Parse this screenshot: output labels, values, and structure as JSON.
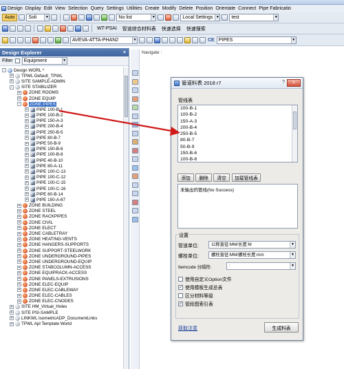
{
  "titlebar": {
    "title": ""
  },
  "menu": [
    "Design",
    "Display",
    "Edit",
    "View",
    "Selection",
    "Query",
    "Settings",
    "Utilities",
    "Create",
    "Modify",
    "Delete",
    "Position",
    "Orientate",
    "Connect",
    "Pipe Fabricatio"
  ],
  "toolbar1": {
    "auto_label": "Auto",
    "solid_value": "Soli",
    "list_value": "No list",
    "settings_value": "Local Settings",
    "test_value": "test"
  },
  "toolbar2": {
    "wt_psai": "WT-PSAI",
    "mto_label": "管道综合材料表",
    "quick_select": "快速选择",
    "quick_search": "快速搜索"
  },
  "toolbar3": {
    "ref_value": "AVEVA-ATTA-PHAN2",
    "ce_label": "CE",
    "ce_value": "PIPES"
  },
  "explorer": {
    "title": "Design Explorer",
    "close": "×",
    "filter_label": "Filter",
    "filter_value": "Equipment",
    "tree": [
      {
        "label": "Design WORL *",
        "level": 0,
        "exp": "-",
        "icon": "world"
      },
      {
        "label": "TPWL Default_TPWL",
        "level": 1,
        "exp": "+",
        "icon": "site"
      },
      {
        "label": "SITE SAMPLE-ADMIN",
        "level": 1,
        "exp": "+",
        "icon": "site"
      },
      {
        "label": "SITE STABILIZER",
        "level": 1,
        "exp": "-",
        "icon": "site"
      },
      {
        "label": "ZONE ROOMS",
        "level": 2,
        "exp": "+",
        "icon": "zone"
      },
      {
        "label": "ZONE EQUIP",
        "level": 2,
        "exp": "+",
        "icon": "zone"
      },
      {
        "label": "ZONE PIPES",
        "level": 2,
        "exp": "-",
        "icon": "zone",
        "selected": true
      },
      {
        "label": "PIPE 100-B-1",
        "level": 3,
        "exp": "+",
        "icon": "pipe"
      },
      {
        "label": "PIPE 100-B-2",
        "level": 3,
        "exp": "+",
        "icon": "pipe"
      },
      {
        "label": "PIPE 150-A-3",
        "level": 3,
        "exp": "+",
        "icon": "pipe"
      },
      {
        "label": "PIPE 200-B-4",
        "level": 3,
        "exp": "+",
        "icon": "pipe"
      },
      {
        "label": "PIPE 250-B-5",
        "level": 3,
        "exp": "+",
        "icon": "pipe"
      },
      {
        "label": "PIPE 80-B-7",
        "level": 3,
        "exp": "+",
        "icon": "pipe"
      },
      {
        "label": "PIPE 50-B-9",
        "level": 3,
        "exp": "+",
        "icon": "pipe"
      },
      {
        "label": "PIPE 150-B-6",
        "level": 3,
        "exp": "+",
        "icon": "pipe"
      },
      {
        "label": "PIPE 100-B-8",
        "level": 3,
        "exp": "+",
        "icon": "pipe"
      },
      {
        "label": "PIPE 40-B-10",
        "level": 3,
        "exp": "+",
        "icon": "pipe"
      },
      {
        "label": "PIPE 80-A-11",
        "level": 3,
        "exp": "+",
        "icon": "pipe"
      },
      {
        "label": "PIPE 100-C-13",
        "level": 3,
        "exp": "+",
        "icon": "pipe"
      },
      {
        "label": "PIPE 100-C-12",
        "level": 3,
        "exp": "+",
        "icon": "pipe"
      },
      {
        "label": "PIPE 100-C-15",
        "level": 3,
        "exp": "+",
        "icon": "pipe"
      },
      {
        "label": "PIPE 100-C-16",
        "level": 3,
        "exp": "+",
        "icon": "pipe"
      },
      {
        "label": "PIPE 80-B-14",
        "level": 3,
        "exp": "+",
        "icon": "pipe"
      },
      {
        "label": "PIPE 150-A-67",
        "level": 3,
        "exp": "+",
        "icon": "pipe"
      },
      {
        "label": "ZONE BUILDING",
        "level": 2,
        "exp": "+",
        "icon": "zone"
      },
      {
        "label": "ZONE STEEL",
        "level": 2,
        "exp": "+",
        "icon": "zone"
      },
      {
        "label": "ZONE RACKPIPES",
        "level": 2,
        "exp": "+",
        "icon": "zone"
      },
      {
        "label": "ZONE CIVIL",
        "level": 2,
        "exp": "+",
        "icon": "zone"
      },
      {
        "label": "ZONE ELECT",
        "level": 2,
        "exp": "+",
        "icon": "zone"
      },
      {
        "label": "ZONE CABLETRAY",
        "level": 2,
        "exp": "+",
        "icon": "zone"
      },
      {
        "label": "ZONE HEATING-VENTS",
        "level": 2,
        "exp": "+",
        "icon": "zone"
      },
      {
        "label": "ZONE HANGERS-SUPPORTS",
        "level": 2,
        "exp": "+",
        "icon": "zone"
      },
      {
        "label": "ZONE SUPPORT-STEELWORK",
        "level": 2,
        "exp": "+",
        "icon": "zone"
      },
      {
        "label": "ZONE UNDERGROUND-PIPES",
        "level": 2,
        "exp": "+",
        "icon": "zone"
      },
      {
        "label": "ZONE UNDERGROUND-EQUIP",
        "level": 2,
        "exp": "+",
        "icon": "zone"
      },
      {
        "label": "ZONE STABCOLUMN-ACCESS",
        "level": 2,
        "exp": "+",
        "icon": "zone"
      },
      {
        "label": "ZONE EQUIPRACK-ACCESS",
        "level": 2,
        "exp": "+",
        "icon": "zone"
      },
      {
        "label": "ZONE PANELS-EXTRUSIONS",
        "level": 2,
        "exp": "+",
        "icon": "zone"
      },
      {
        "label": "ZONE ELEC-EQUIP",
        "level": 2,
        "exp": "+",
        "icon": "zone"
      },
      {
        "label": "ZONE ELEC-CABLEWAY",
        "level": 2,
        "exp": "+",
        "icon": "zone"
      },
      {
        "label": "ZONE ELEC-CABLES",
        "level": 2,
        "exp": "+",
        "icon": "zone"
      },
      {
        "label": "ZONE ELEC-CNODES",
        "level": 2,
        "exp": "+",
        "icon": "zone"
      },
      {
        "label": "SITE HM_Virtual_Holes",
        "level": 1,
        "exp": "+",
        "icon": "site"
      },
      {
        "label": "SITE PSI-SAMPLE",
        "level": 1,
        "exp": "+",
        "icon": "site"
      },
      {
        "label": "LINKWL IsometricADP_DocumentLinks",
        "level": 1,
        "exp": "+",
        "icon": "site"
      },
      {
        "label": "TPWL Apl Template World",
        "level": 1,
        "exp": "+",
        "icon": "site"
      }
    ]
  },
  "navigate_label": "Navigate :",
  "dialog": {
    "title": "管道料表 2018 r7",
    "help": "?",
    "close": "×",
    "pipe_table_label": "管线表",
    "pipes": [
      "100-B-1",
      "100-B-2",
      "150-A-3",
      "200-B-4",
      "250-B-5",
      "80-B-7",
      "50-B-9",
      "150-B-6",
      "100-B-8"
    ],
    "btn_add": "添加",
    "btn_delete": "删除",
    "btn_clear": "清空",
    "btn_load": "加载管线表",
    "message": "未输出的管线(No Success)",
    "settings_label": "设置",
    "pipe_unit_label": "管道单位:",
    "pipe_unit_value": "公称直径:MM/长度:M",
    "bolt_unit_label": "螺栓单位:",
    "bolt_unit_value": "螺栓直径:MM/螺栓长度:mm",
    "itemcode_label": "Itemcode 分隔符:",
    "itemcode_value": ":",
    "chk_custom_option": "使用自定义Option文件",
    "chk_template": "使用模板生成总表",
    "chk_material_grade": "区分材料等级",
    "chk_drawing_index": "管段图索引表",
    "checks_state": [
      false,
      true,
      false,
      true
    ],
    "get_notes": "获取注意",
    "btn_generate": "生成料表"
  },
  "colors": {
    "arrow": "#d01818",
    "selection": "#3a6fc4",
    "explorer_title": "#4a70aa"
  }
}
